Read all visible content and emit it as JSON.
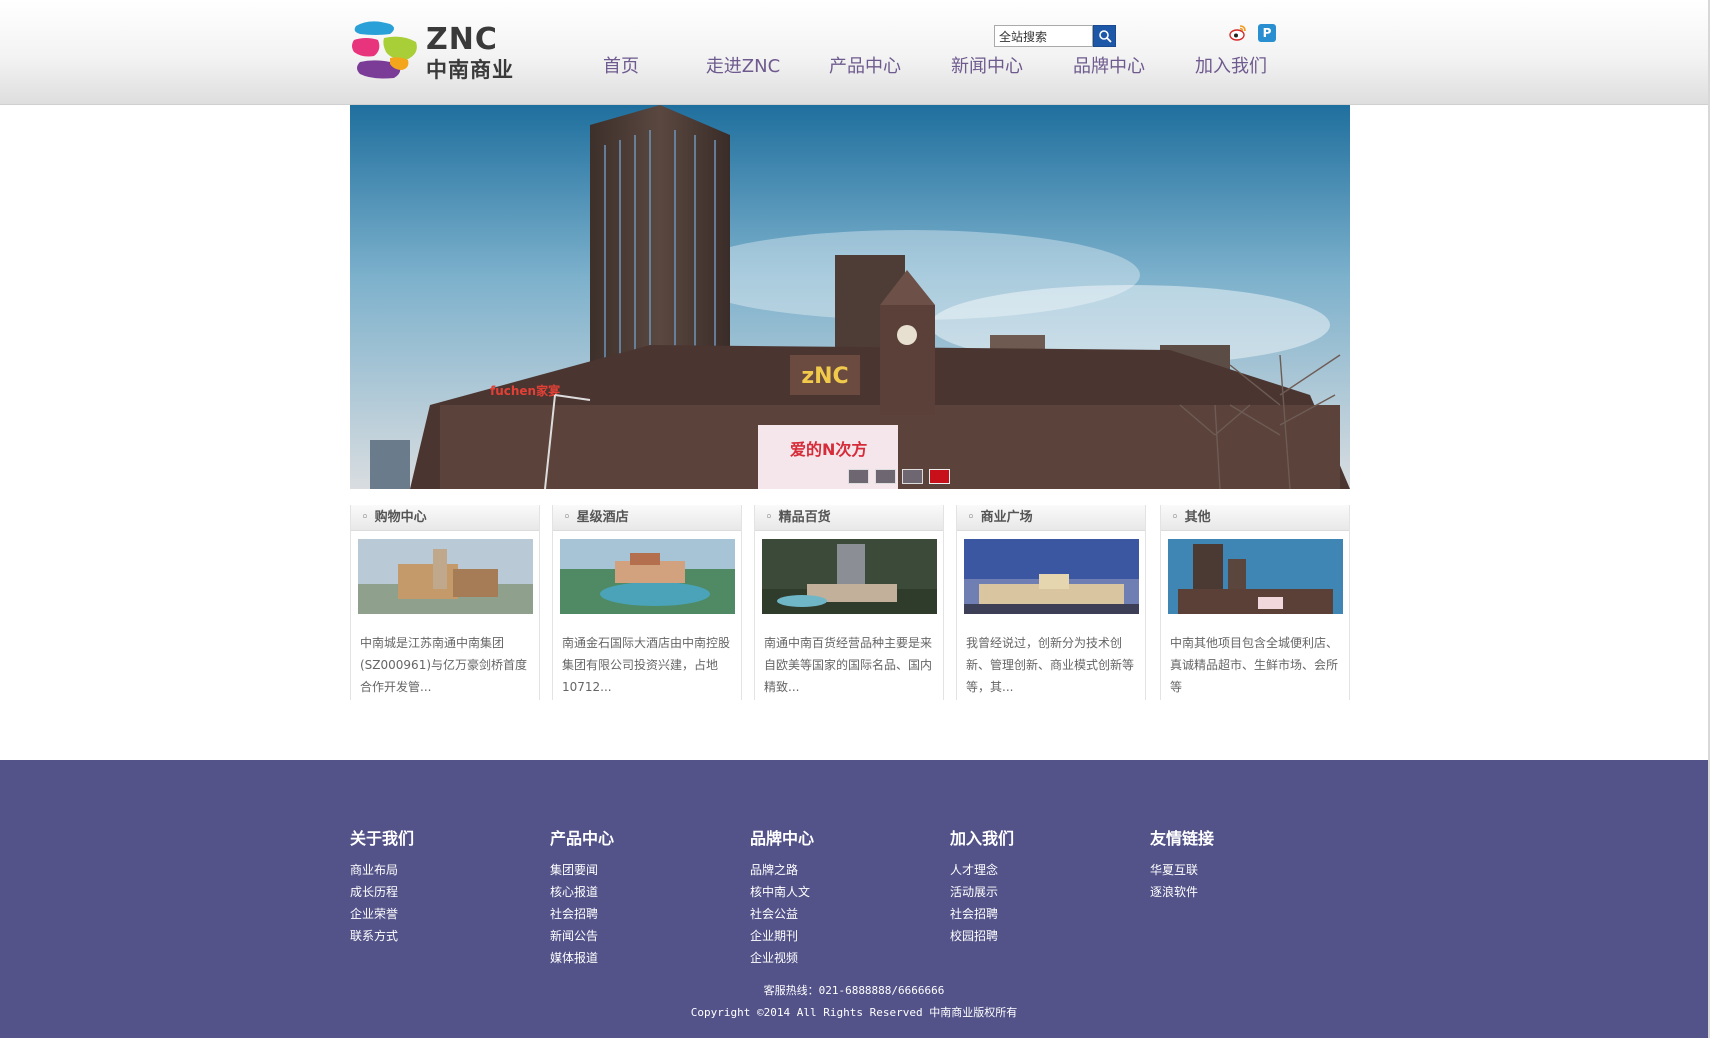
{
  "header": {
    "logo": {
      "top": "ZNC",
      "bottom": "中南商业"
    },
    "search": {
      "value": "全站搜索"
    },
    "nav": [
      "首页",
      "走进ZNC",
      "产品中心",
      "新闻中心",
      "品牌中心",
      "加入我们"
    ],
    "social_icons": [
      "weibo-icon",
      "qq-icon"
    ]
  },
  "banner": {
    "slides": 4,
    "active_slide": 4,
    "sign_text": "爱的N次方",
    "brand_text": "fuchen家宴"
  },
  "cards": [
    {
      "title": "购物中心",
      "text": "中南城是江苏南通中南集团(SZ000961)与亿万豪剑桥首度合作开发管..."
    },
    {
      "title": "星级酒店",
      "text": "南通金石国际大酒店由中南控股集团有限公司投资兴建，占地10712..."
    },
    {
      "title": "精品百货",
      "text": "南通中南百货经营品种主要是来自欧美等国家的国际名品、国内精致..."
    },
    {
      "title": "商业广场",
      "text": "我曾经说过，创新分为技术创新、管理创新、商业模式创新等等，其..."
    },
    {
      "title": "其他",
      "text": "中南其他项目包含全城便利店、真诚精品超市、生鲜市场、会所等"
    }
  ],
  "footer": {
    "columns": [
      {
        "title": "关于我们",
        "links": [
          "商业布局",
          "成长历程",
          "企业荣誉",
          "联系方式"
        ]
      },
      {
        "title": "产品中心",
        "links": [
          "集团要闻",
          "核心报道",
          "社会招聘",
          "新闻公告",
          "媒体报道"
        ]
      },
      {
        "title": "品牌中心",
        "links": [
          "品牌之路",
          "核中南人文",
          "社会公益",
          "企业期刊",
          "企业视频"
        ]
      },
      {
        "title": "加入我们",
        "links": [
          "人才理念",
          "活动展示",
          "社会招聘",
          "校园招聘"
        ]
      },
      {
        "title": "友情链接",
        "links": [
          "华夏互联",
          "逐浪软件"
        ]
      }
    ],
    "hotline": "客服热线：021-6888888/6666666",
    "copyright": "Copyright ©2014 All Rights Reserved 中南商业版权所有"
  },
  "colors": {
    "nav_text": "#6e5a8e",
    "footer_bg": "#53538a",
    "search_button": "#1d57a8",
    "active_dot": "#c8101a"
  }
}
